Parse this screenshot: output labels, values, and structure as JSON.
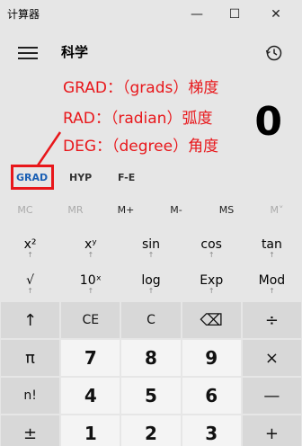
{
  "window": {
    "title": "计算器",
    "minimize_glyph": "—",
    "maximize_glyph": "☐",
    "close_glyph": "✕"
  },
  "header": {
    "mode_title": "科学",
    "menu_icon": "hamburger-icon",
    "history_icon": "history-icon"
  },
  "annotations": [
    "GRAD：（grads）梯度",
    "RAD：（radian）弧度",
    "DEG：（degree）角度"
  ],
  "annotation_color": "#e8171b",
  "display": {
    "value": "0"
  },
  "mode_bar": {
    "angle": "GRAD",
    "hyp": "HYP",
    "fe": "F-E"
  },
  "memory": [
    "MC",
    "MR",
    "M+",
    "M-",
    "MS",
    "M˅"
  ],
  "sci_rows": [
    [
      "x²",
      "xʸ",
      "sin",
      "cos",
      "tan"
    ],
    [
      "√",
      "10ˣ",
      "log",
      "Exp",
      "Mod"
    ]
  ],
  "sci_arrow": "↑",
  "keypad": [
    [
      "↑",
      "CE",
      "C",
      "⌫",
      "÷"
    ],
    [
      "π",
      "7",
      "8",
      "9",
      "×"
    ],
    [
      "n!",
      "4",
      "5",
      "6",
      "—"
    ],
    [
      "±",
      "1",
      "2",
      "3",
      "+"
    ]
  ],
  "accent_color": "#1a5fb4"
}
